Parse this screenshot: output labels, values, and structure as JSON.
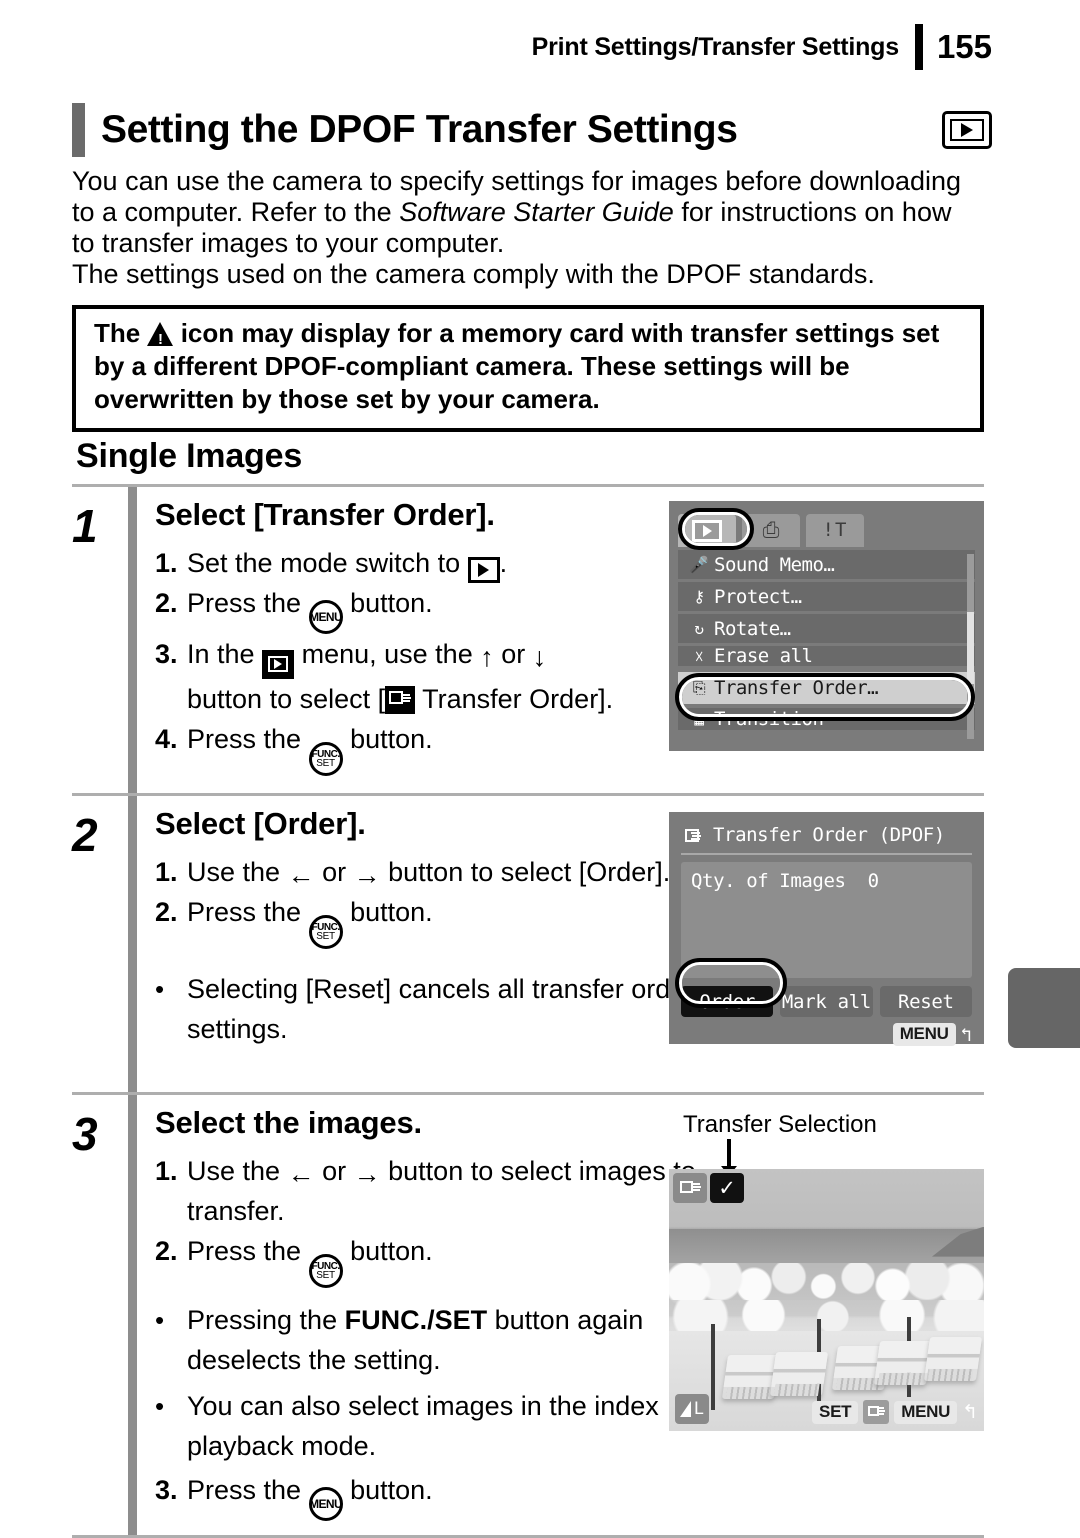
{
  "header": {
    "section_title": "Print Settings/Transfer Settings",
    "page_number": "155"
  },
  "title": {
    "text": "Setting the DPOF Transfer Settings",
    "icon": "playback-mode-icon"
  },
  "intro": {
    "line1_a": "You can use the camera to specify settings for images before downloading to a computer. Refer to the ",
    "line1_italic": "Software Starter Guide",
    "line1_b": " for instructions on how to transfer images to your computer.",
    "line2": "The settings used on the camera comply with the DPOF standards."
  },
  "warning": {
    "text_a": "The",
    "icon": "warning-triangle-icon",
    "text_b": "icon may display for a memory card with transfer settings set by a different DPOF-compliant camera. These settings will be overwritten by those set by your camera."
  },
  "section_heading": "Single Images",
  "steps": [
    {
      "number": "1",
      "title": "Select [Transfer Order].",
      "items": [
        {
          "marker": "1.",
          "text_a": "Set the mode switch to",
          "icon": "playback-mode-switch-icon",
          "text_b": "."
        },
        {
          "marker": "2.",
          "text_a": "Press the",
          "icon": "menu-button-icon",
          "text_b": "button."
        },
        {
          "marker": "3.",
          "text_a": "In the",
          "icon": "playback-menu-icon",
          "text_b": "menu, use the",
          "arrow_up": "↑",
          "text_c": "or",
          "arrow_down": "↓",
          "text_d": "button to select [",
          "icon2": "transfer-order-icon",
          "text_e": "Transfer Order]."
        },
        {
          "marker": "4.",
          "text_a": "Press the",
          "icon": "func-set-button-icon",
          "text_b": "button."
        }
      ],
      "bullets": []
    },
    {
      "number": "2",
      "title": "Select [Order].",
      "items": [
        {
          "marker": "1.",
          "text_a": "Use the",
          "arrow_left": "←",
          "text_b": "or",
          "arrow_right": "→",
          "text_c": "button to select [Order]."
        },
        {
          "marker": "2.",
          "text_a": "Press the",
          "icon": "func-set-button-icon",
          "text_b": "button."
        }
      ],
      "bullets": [
        {
          "marker": "•",
          "text": "Selecting [Reset] cancels all transfer order settings."
        }
      ]
    },
    {
      "number": "3",
      "title": "Select the images.",
      "items": [
        {
          "marker": "1.",
          "text_a": "Use the",
          "arrow_left": "←",
          "text_b": "or",
          "arrow_right": "→",
          "text_c": "button to select images to transfer."
        },
        {
          "marker": "2.",
          "text_a": "Press the",
          "icon": "func-set-button-icon",
          "text_b": "button."
        }
      ],
      "bullets": [
        {
          "marker": "•",
          "text_a": "Pressing the",
          "bold": "FUNC./SET",
          "text_b": "button again deselects the setting."
        },
        {
          "marker": "•",
          "text": "You can also select images in the index playback mode."
        }
      ],
      "last_item": {
        "marker": "3.",
        "text_a": "Press the",
        "icon": "menu-button-icon",
        "text_b": "button."
      }
    }
  ],
  "lcd_menu": {
    "tabs": [
      {
        "name": "playback-tab",
        "selected": true
      },
      {
        "name": "print-tab",
        "glyph": "⎙",
        "selected": false
      },
      {
        "name": "setup-tab",
        "glyph": "!T",
        "selected": false
      }
    ],
    "rows": [
      {
        "icon": "microphone-icon",
        "label": "Sound Memo…",
        "highlighted": false
      },
      {
        "icon": "key-icon",
        "label": "Protect…",
        "highlighted": false
      },
      {
        "icon": "rotate-icon",
        "label": "Rotate…",
        "highlighted": false
      },
      {
        "icon": "erase-all-icon",
        "label": "Erase all",
        "highlighted": false
      },
      {
        "icon": "transfer-order-icon",
        "label": "Transfer Order…",
        "highlighted": true
      },
      {
        "icon": "transition-icon",
        "label": "Transition",
        "highlighted": false
      }
    ]
  },
  "lcd_order": {
    "title": "Transfer Order (DPOF)",
    "qty_label": "Qty. of Images",
    "qty_value": "0",
    "buttons": [
      {
        "label": "Order",
        "active": true
      },
      {
        "label": "Mark all",
        "active": false
      },
      {
        "label": "Reset",
        "active": false
      }
    ],
    "menu_key": "MENU",
    "return_arrow": "↰"
  },
  "lcd_photo": {
    "callout": "Transfer Selection",
    "check_glyph": "✓",
    "set_key": "SET",
    "menu_key": "MENU",
    "return_arrow": "↰",
    "resolution": "L"
  },
  "colors": {
    "rule_gray": "#aeaeae",
    "step_bar": "#8d8d8d",
    "lcd_bg": "#7b7b7b",
    "highlight": "#cfcfcf",
    "margin_tab": "#666666"
  }
}
